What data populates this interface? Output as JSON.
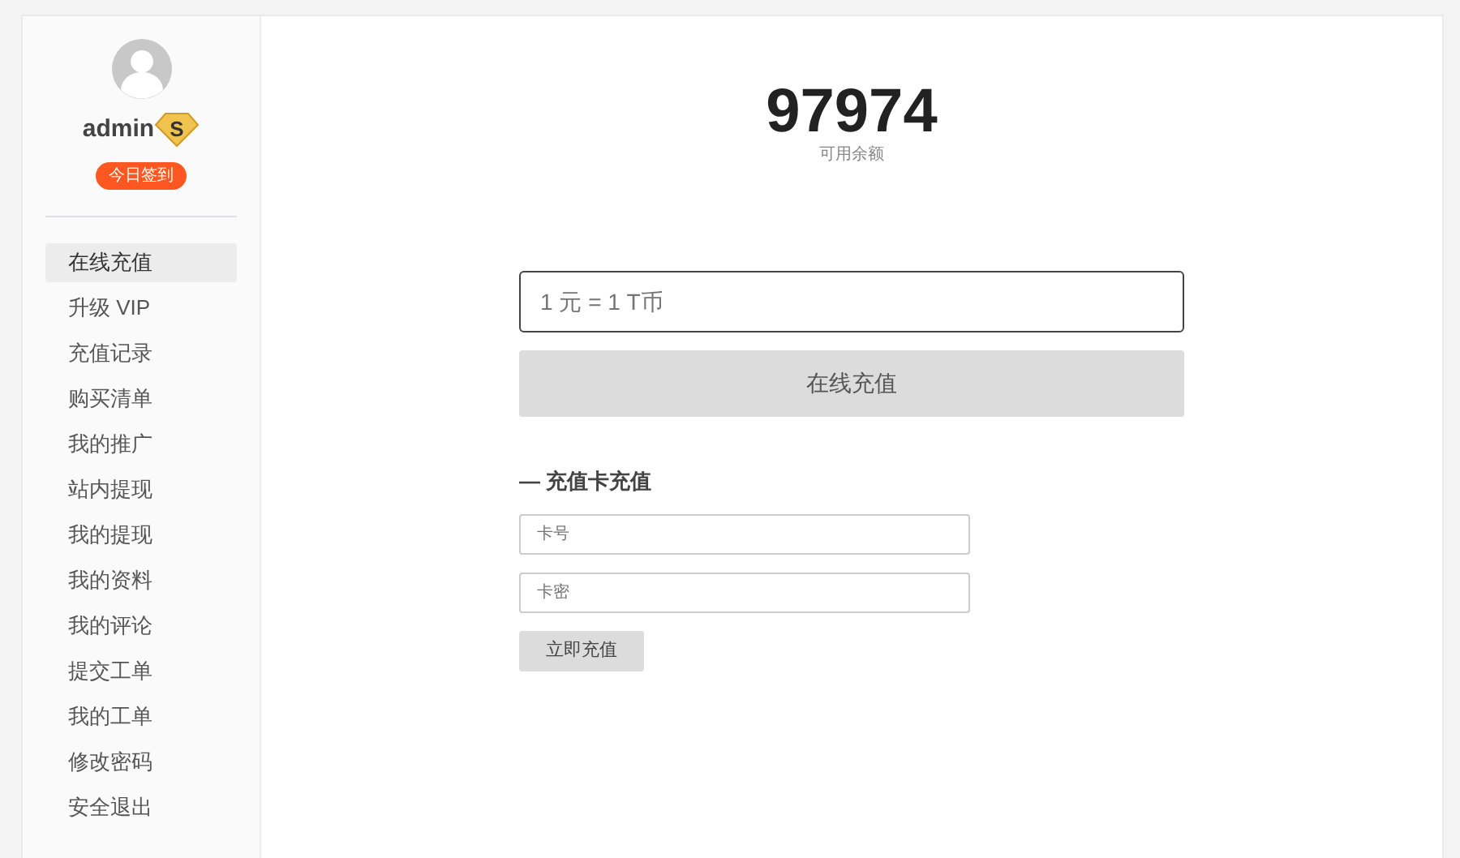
{
  "user": {
    "name": "admin",
    "level_badge": "S",
    "checkin_button": "今日签到"
  },
  "menu": [
    {
      "label": "在线充值",
      "selected": true
    },
    {
      "label": "升级 VIP",
      "selected": false
    },
    {
      "label": "充值记录",
      "selected": false
    },
    {
      "label": "购买清单",
      "selected": false
    },
    {
      "label": "我的推广",
      "selected": false
    },
    {
      "label": "站内提现",
      "selected": false
    },
    {
      "label": "我的提现",
      "selected": false
    },
    {
      "label": "我的资料",
      "selected": false
    },
    {
      "label": "我的评论",
      "selected": false
    },
    {
      "label": "提交工单",
      "selected": false
    },
    {
      "label": "我的工单",
      "selected": false
    },
    {
      "label": "修改密码",
      "selected": false
    },
    {
      "label": "安全退出",
      "selected": false
    }
  ],
  "balance": {
    "amount": "97974",
    "label": "可用余额"
  },
  "online_recharge": {
    "placeholder": "1 元 = 1 T币",
    "button": "在线充值"
  },
  "card_recharge": {
    "title": "— 充值卡充值",
    "card_number_placeholder": "卡号",
    "card_password_placeholder": "卡密",
    "button": "立即充值"
  }
}
